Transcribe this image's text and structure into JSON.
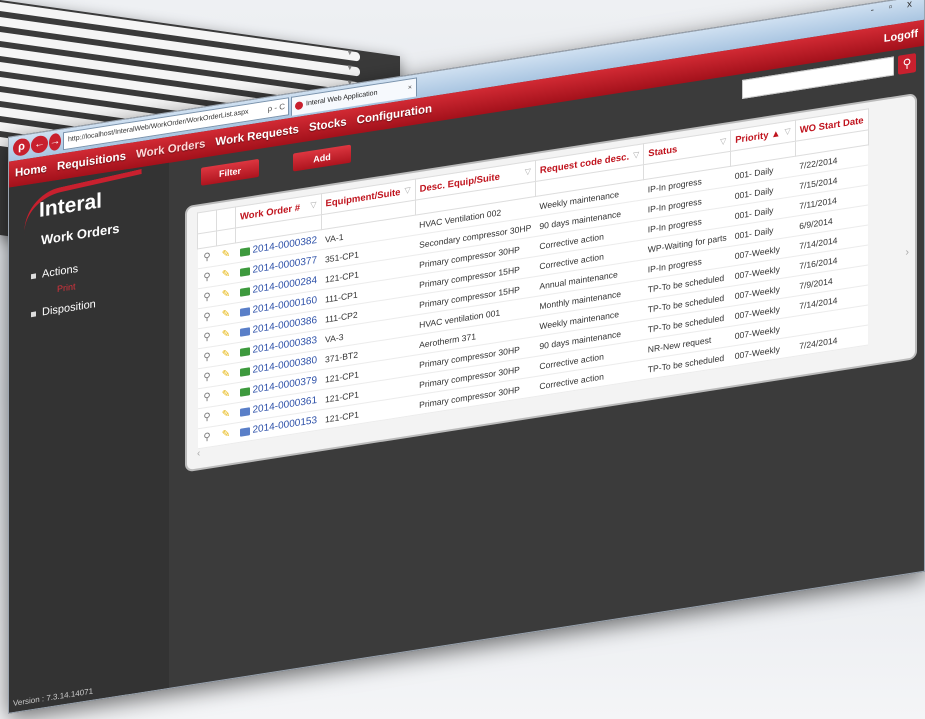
{
  "browser": {
    "address": "http://localhost/InteralWeb/WorkOrder/WorkOrderList.aspx",
    "address_controls": "ρ - C",
    "tab_title": "Interal Web Application",
    "window_controls": "- ▫ x",
    "toolbar_icons": "★ ✿"
  },
  "menu": {
    "items": [
      "Home",
      "Requisitions",
      "Work Orders",
      "Work Requests",
      "Stocks",
      "Configuration"
    ],
    "selected": "Work Orders",
    "logoff": "Logoff"
  },
  "sidebar": {
    "logo": "Interal",
    "title": "Work Orders",
    "items": [
      {
        "label": "Actions",
        "sub": "Print"
      },
      {
        "label": "Disposition"
      }
    ],
    "version": "Version : 7.3.14.14071"
  },
  "actions": {
    "filter": "Filter",
    "add": "Add"
  },
  "table": {
    "columns": [
      "Work Order #",
      "Equipment/Suite",
      "Desc. Equip/Suite",
      "Request code desc.",
      "Status",
      "Priority ▲",
      "WO Start Date"
    ],
    "rows": [
      {
        "wo": "2014-0000382",
        "equip": "VA-1",
        "desc": "HVAC Ventilation 002",
        "req": "Weekly maintenance",
        "status": "IP-In progress",
        "priority": "001- Daily",
        "date": "7/22/2014",
        "type": "g"
      },
      {
        "wo": "2014-0000377",
        "equip": "351-CP1",
        "desc": "Secondary compressor 30HP",
        "req": "90 days maintenance",
        "status": "IP-In progress",
        "priority": "001- Daily",
        "date": "7/15/2014",
        "type": "g"
      },
      {
        "wo": "2014-0000284",
        "equip": "121-CP1",
        "desc": "Primary compressor 30HP",
        "req": "Corrective action",
        "status": "IP-In progress",
        "priority": "001- Daily",
        "date": "7/11/2014",
        "type": "g"
      },
      {
        "wo": "2014-0000160",
        "equip": "111-CP1",
        "desc": "Primary compressor 15HP",
        "req": "Corrective action",
        "status": "WP-Waiting for parts",
        "priority": "001- Daily",
        "date": "6/9/2014",
        "type": "b"
      },
      {
        "wo": "2014-0000386",
        "equip": "111-CP2",
        "desc": "Primary compressor 15HP",
        "req": "Annual maintenance",
        "status": "IP-In progress",
        "priority": "007-Weekly",
        "date": "7/14/2014",
        "type": "b"
      },
      {
        "wo": "2014-0000383",
        "equip": "VA-3",
        "desc": "HVAC ventilation 001",
        "req": "Monthly maintenance",
        "status": "TP-To be scheduled",
        "priority": "007-Weekly",
        "date": "7/16/2014",
        "type": "g"
      },
      {
        "wo": "2014-0000380",
        "equip": "371-BT2",
        "desc": "Aerotherm 371",
        "req": "Weekly maintenance",
        "status": "TP-To be scheduled",
        "priority": "007-Weekly",
        "date": "7/9/2014",
        "type": "g"
      },
      {
        "wo": "2014-0000379",
        "equip": "121-CP1",
        "desc": "Primary compressor 30HP",
        "req": "90 days maintenance",
        "status": "TP-To be scheduled",
        "priority": "007-Weekly",
        "date": "7/14/2014",
        "type": "g"
      },
      {
        "wo": "2014-0000361",
        "equip": "121-CP1",
        "desc": "Primary compressor 30HP",
        "req": "Corrective action",
        "status": "NR-New request",
        "priority": "007-Weekly",
        "date": "",
        "type": "b"
      },
      {
        "wo": "2014-0000153",
        "equip": "121-CP1",
        "desc": "Primary compressor 30HP",
        "req": "Corrective action",
        "status": "TP-To be scheduled",
        "priority": "007-Weekly",
        "date": "7/24/2014",
        "type": "b"
      }
    ]
  },
  "colors": {
    "brand_red": "#c8202e",
    "dark_bg": "#3b3b3b",
    "link_blue": "#2b4fa8"
  }
}
